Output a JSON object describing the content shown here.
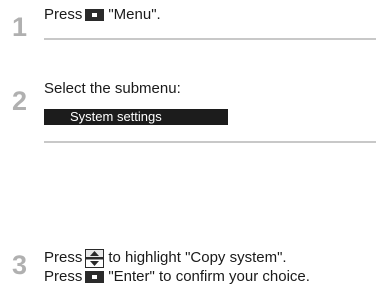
{
  "steps": [
    {
      "number": "1",
      "line1_pre": "Press",
      "line1_post": "\"Menu\"."
    },
    {
      "number": "2",
      "line1": "Select the submenu:",
      "menu_item": "System settings"
    },
    {
      "number": "3",
      "line1_pre": "Press",
      "line1_post": "to highlight \"Copy system\".",
      "line2_pre": "Press",
      "line2_post": "\"Enter\" to confirm your choice."
    }
  ],
  "icons": {
    "menu_key": "menu-key-icon",
    "updown_key": "up-down-arrow-icon",
    "enter_key": "enter-key-icon"
  },
  "colors": {
    "step_number": "#b0b0b0",
    "separator": "#c8c8c8",
    "menu_bar_bg": "#1c1c1c",
    "menu_bar_text": "#ffffff"
  }
}
